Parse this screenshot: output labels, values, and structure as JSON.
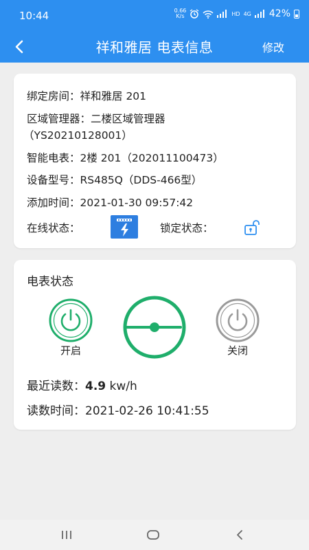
{
  "status_bar": {
    "time": "10:44",
    "net_speed_value": "0.66",
    "net_speed_unit": "K/s",
    "net_label_1": "4G",
    "net_label_2": "HD",
    "battery": "42%"
  },
  "header": {
    "title": "祥和雅居 电表信息",
    "edit_label": "修改"
  },
  "info": {
    "room_label": "绑定房间：",
    "room_value": "祥和雅居 201",
    "manager_label": "区域管理器：",
    "manager_value": "二楼区域管理器",
    "manager_id": "（YS20210128001）",
    "meter_label": "智能电表：",
    "meter_value": "2楼 201（202011100473）",
    "model_label": "设备型号：",
    "model_value": "RS485Q（DDS-466型）",
    "added_label": "添加时间：",
    "added_value": "2021-01-30 09:57:42",
    "online_label": "在线状态：",
    "lock_label": "锁定状态：",
    "online_icon": "power-online-icon",
    "lock_icon": "unlocked-padlock-icon"
  },
  "meter_status": {
    "title": "电表状态",
    "on_label": "开启",
    "off_label": "关闭",
    "reading_label": "最近读数：",
    "reading_value": "4.9",
    "reading_unit": " kw/h",
    "time_label": "读数时间：",
    "time_value": "2021-02-26 10:41:55",
    "colors": {
      "on": "#1fae6b",
      "off": "#9a9a9a",
      "primary": "#2d8ff0"
    }
  }
}
